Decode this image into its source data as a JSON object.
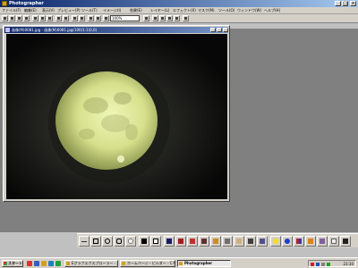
{
  "window": {
    "title": "Photographer"
  },
  "menu": [
    "ファイル(F)",
    "編集(E)",
    "表示(V)",
    "プレビュー(P)",
    "ツール(T)",
    "イメージ(I)",
    "効果(E)",
    "レイヤー(L)",
    "エフェクト(X)",
    "マスク(M)",
    "ツール(O)",
    "ウィンドウ(W)",
    "ヘルプ(H)"
  ],
  "toolbar": {
    "zoom_value": "100%"
  },
  "document": {
    "title": "画像(M)0081.jpg - 画像(M)0081.jpg(100)1:1(0,0)"
  },
  "taskbar": {
    "start_label": "スタート",
    "tasks": [
      "Eグラフエクスプローラー - 2004年9月",
      "ホームページ・ビルダー - C:¥Doc...",
      "Photographer"
    ],
    "clock": "23:30"
  },
  "palette": {
    "tools": [
      "line-tool",
      "rect-tool",
      "ellipse-tool",
      "rounded-rect-tool",
      "ellipse-fill-tool",
      "black-swatch",
      "white-swatch",
      "pen-tool",
      "marker-tool",
      "brush-red-tool",
      "brush-dark-tool",
      "pencil-tool",
      "airbrush-tool",
      "eraser-tool",
      "scissors-tool",
      "fill-tool",
      "yellow-circle-tool",
      "blue-circle-tool",
      "gradient-tool",
      "stamp-tool",
      "eyedropper-tool",
      "arrow-tool",
      "text-tool"
    ]
  },
  "colors": {
    "title_bar": "#0a246a",
    "desktop_gray": "#808080",
    "moon_core": "#e8f2a8",
    "moon_edge": "#9aa455"
  }
}
